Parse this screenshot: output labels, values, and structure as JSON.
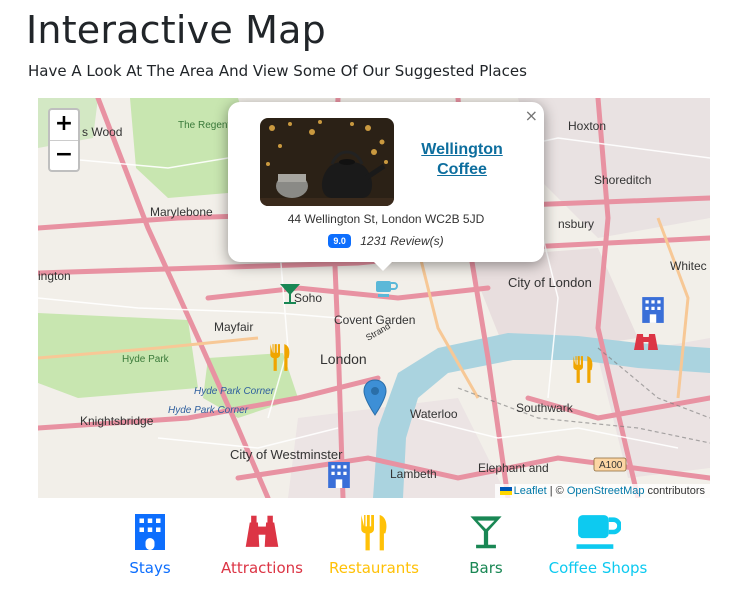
{
  "page": {
    "title": "Interactive Map",
    "subtitle": "Have A Look At The Area And View Some Of Our Suggested Places"
  },
  "map": {
    "zoom_in": "+",
    "zoom_out": "−",
    "labels": {
      "wood": "s Wood",
      "regents_park": "The Regent's Park",
      "marylebone": "Marylebone",
      "hoxton": "Hoxton",
      "shoreditch": "Shoreditch",
      "finsbury": "nsbury",
      "whitechapel": "Whitec",
      "kensington": "ington",
      "soho": "Soho",
      "city_of_london": "City of London",
      "mayfair": "Mayfair",
      "covent_garden": "Covent Garden",
      "london": "London",
      "hyde_park": "Hyde Park",
      "hyde_park_corner": "Hyde Park Corner",
      "hyde_park_corner_2": "Hyde Park Corner",
      "knightsbridge": "Knightsbridge",
      "waterloo": "Waterloo",
      "southwark": "Southwark",
      "city_of_westminster": "City of Westminster",
      "lambeth": "Lambeth",
      "elephant_and_castle": "Elephant and",
      "strand": "Strand",
      "a100": "A100"
    },
    "attribution": {
      "leaflet": "Leaflet",
      "separator": " | © ",
      "osm": "OpenStreetMap",
      "contributors": " contributors"
    }
  },
  "popup": {
    "close": "×",
    "title": "Wellington Coffee",
    "address": "44 Wellington St, London WC2B 5JD",
    "rating": "9.0",
    "reviews": "1231 Review(s)"
  },
  "legend": [
    {
      "label": "Stays",
      "icon": "hotel-icon",
      "color": "#0d6efd"
    },
    {
      "label": "Attractions",
      "icon": "binoculars-icon",
      "color": "#dc3545"
    },
    {
      "label": "Restaurants",
      "icon": "utensils-icon",
      "color": "#ffc107"
    },
    {
      "label": "Bars",
      "icon": "cocktail-icon",
      "color": "#198754"
    },
    {
      "label": "Coffee Shops",
      "icon": "coffee-icon",
      "color": "#0dcaf0"
    }
  ]
}
